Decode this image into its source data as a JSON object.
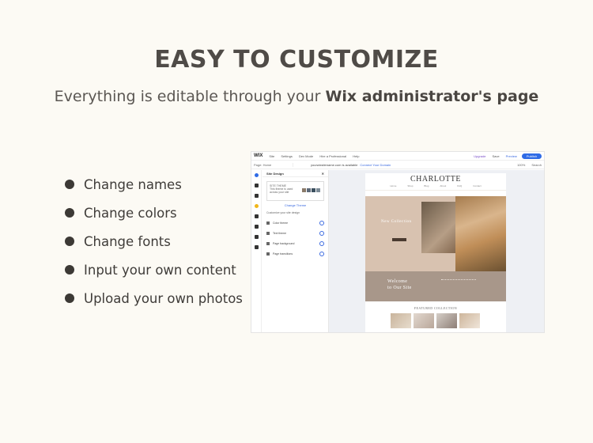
{
  "hero": {
    "title": "EASY TO CUSTOMIZE",
    "subtitle_prefix": "Everything is editable through your ",
    "subtitle_bold": "Wix administrator's page"
  },
  "features": [
    "Change names",
    "Change colors",
    "Change fonts",
    "Input your own content",
    "Upload your own photos"
  ],
  "editor": {
    "logo": "WIX",
    "menu": [
      "Site",
      "Settings",
      "Dev Mode",
      "Hire a Professional",
      "Help"
    ],
    "upgrade": "Upgrade",
    "save": "Save",
    "preview": "Preview",
    "publish": "Publish",
    "page_select": "Page: Home",
    "url": "yourwixsitename.com is available",
    "connect": "Connect Your Domain",
    "zoom": "100%",
    "search": "Search",
    "panel": {
      "title": "Site Design",
      "theme_label": "SITE THEME",
      "theme_desc": "This theme is used across your site",
      "change_theme": "Change Theme",
      "customize_line": "Customize your site design",
      "options": [
        "Color theme",
        "Text theme",
        "Page background",
        "Page transitions"
      ],
      "swatch_colors": [
        "#8a7a6a",
        "#5d6a7a",
        "#3b4f5e",
        "#7b8a96"
      ]
    },
    "site": {
      "brand": "CHARLOTTE",
      "nav": [
        "Home",
        "Shop",
        "Blog",
        "About",
        "FAQ",
        "Contact"
      ],
      "hero_title": "New Collection",
      "welcome_line1": "Welcome",
      "welcome_line2": "to Our Site",
      "featured": "FEATURED COLLECTION"
    }
  },
  "colors": {
    "background": "#fcfaf4",
    "title": "#4f4b47",
    "bullet": "#3c3935",
    "wix_blue": "#2f6be6",
    "hero_beige": "#d8c2b0",
    "welcome_taupe": "#a8978a"
  }
}
